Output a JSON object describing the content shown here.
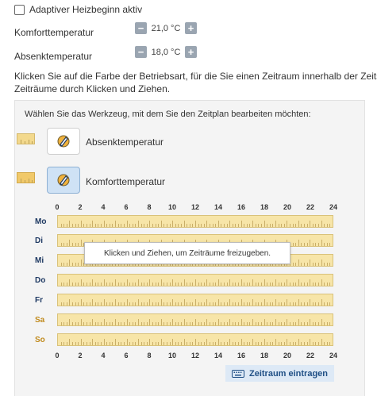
{
  "adaptive": {
    "label": "Adaptiver Heizbeginn aktiv",
    "checked": false
  },
  "comfort": {
    "label": "Komforttemperatur",
    "value": "21,0 °C",
    "minus": "−",
    "plus": "+"
  },
  "setback": {
    "label": "Absenktemperatur",
    "value": "18,0 °C",
    "minus": "−",
    "plus": "+"
  },
  "info": {
    "line1": "Klicken Sie auf die Farbe der Betriebsart, für die Sie einen Zeitraum innerhalb der Zeitsteu",
    "line2": "Zeiträume durch Klicken und Ziehen."
  },
  "panel": {
    "title": "Wählen Sie das Werkzeug, mit dem Sie den Zeitplan bearbeiten möchten:",
    "tools": [
      {
        "label": "Absenktemperatur",
        "icon": "edit-pencil-icon",
        "active": false
      },
      {
        "label": "Komforttemperatur",
        "icon": "edit-pencil-icon",
        "active": true
      }
    ]
  },
  "axis_labels": [
    "0",
    "2",
    "4",
    "6",
    "8",
    "10",
    "12",
    "14",
    "16",
    "18",
    "20",
    "22",
    "24"
  ],
  "days": [
    {
      "label": "Mo",
      "weekend": false
    },
    {
      "label": "Di",
      "weekend": false
    },
    {
      "label": "Mi",
      "weekend": false
    },
    {
      "label": "Do",
      "weekend": false
    },
    {
      "label": "Fr",
      "weekend": false
    },
    {
      "label": "Sa",
      "weekend": true
    },
    {
      "label": "So",
      "weekend": true
    }
  ],
  "tooltip": "Klicken und Ziehen, um Zeiträume freizugeben.",
  "add_button": {
    "label": "Zeitraum eintragen",
    "icon": "keyboard-icon"
  },
  "colors": {
    "setback_fill": "#f3d98d",
    "comfort_fill": "#f1c96a",
    "schedule_bar": "#f7e5a8",
    "weekday_label": "#1f3a63",
    "weekend_label": "#c08a1c",
    "button_bg": "#dde9f6"
  }
}
